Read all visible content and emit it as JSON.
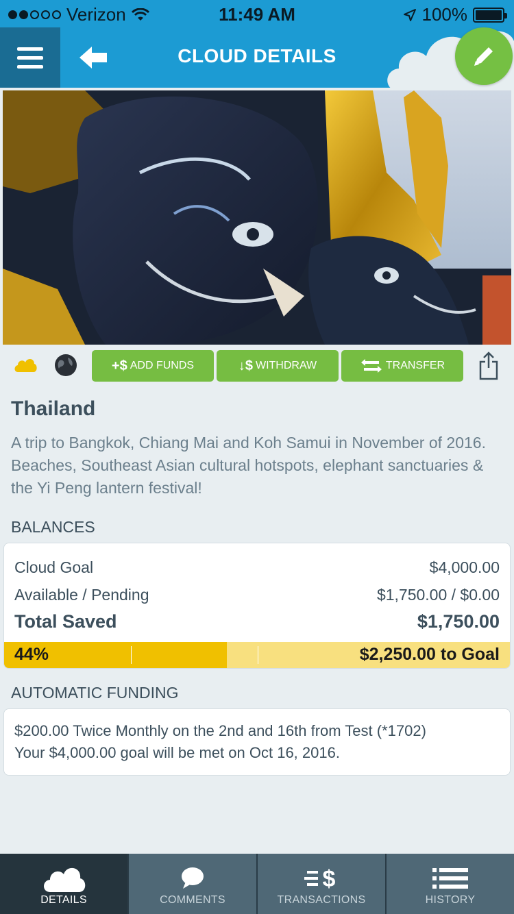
{
  "status_bar": {
    "carrier": "Verizon",
    "time": "11:49 AM",
    "battery": "100%"
  },
  "nav": {
    "title": "CLOUD DETAILS"
  },
  "actions": {
    "add_funds": "ADD FUNDS",
    "withdraw": "WITHDRAW",
    "transfer": "TRANSFER"
  },
  "cloud": {
    "title": "Thailand",
    "description": "A trip to Bangkok, Chiang Mai and Koh Samui in November of 2016. Beaches, Southeast Asian cultural hotspots, elephant sanctuaries & the Yi Peng lantern festival!"
  },
  "balances": {
    "heading": "BALANCES",
    "goal_label": "Cloud Goal",
    "goal_value": "$4,000.00",
    "available_label": "Available / Pending",
    "available_value": "$1,750.00 / $0.00",
    "total_label": "Total Saved",
    "total_value": "$1,750.00",
    "progress_text": "44%",
    "progress_fraction": 0.44,
    "to_goal": "$2,250.00 to Goal"
  },
  "automatic_funding": {
    "heading": "AUTOMATIC FUNDING",
    "line1": "$200.00 Twice Monthly on the 2nd and 16th from Test (*1702)",
    "line2": "Your $4,000.00 goal will be met on Oct 16, 2016."
  },
  "tabs": {
    "details": "DETAILS",
    "comments": "COMMENTS",
    "transactions": "TRANSACTIONS",
    "history": "HISTORY"
  },
  "colors": {
    "nav_blue": "#1c9bd3",
    "menu_blue": "#1a6c93",
    "action_green": "#76bd42",
    "progress_fill": "#f0c000",
    "progress_track": "#f8e07f",
    "tabbar": "#4f6876",
    "tab_active": "#25343d"
  }
}
